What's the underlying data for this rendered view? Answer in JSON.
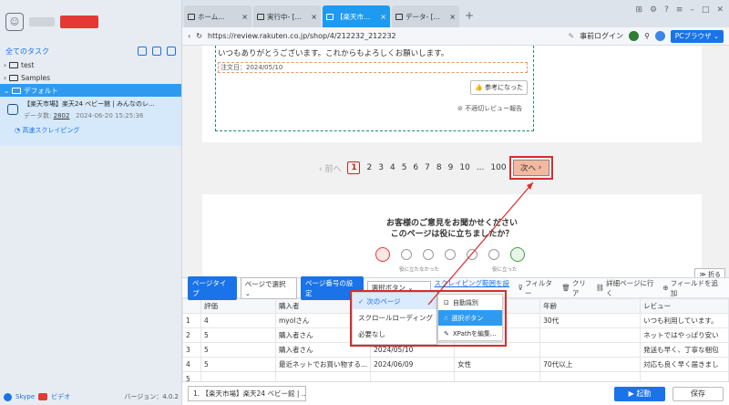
{
  "sidebar": {
    "all_tasks": "全てのタスク",
    "tree": [
      {
        "label": "test"
      },
      {
        "label": "Samples"
      },
      {
        "label": "デフォルト"
      }
    ],
    "task": {
      "title": "【楽天市場】楽天24 ベビー館 | みんなのレ...",
      "count_label": "データ数:",
      "count": "2802",
      "date": "2024-06-20 15:25:36",
      "mode": "高速スクレイピング"
    },
    "footer": {
      "skype": "Skype",
      "video": "ビデオ",
      "version": "バージョン：4.0.2"
    }
  },
  "tabs": [
    {
      "label": "ホーム..."
    },
    {
      "label": "実行中- [..."
    },
    {
      "label": "【楽天市..."
    },
    {
      "label": "データ- [..."
    }
  ],
  "urlbar": {
    "url": "https://review.rakuten.co.jp/shop/4/212232_212232",
    "login": "事前ログイン",
    "browser": "PCブラウザ"
  },
  "page": {
    "thanks": "いつもありがとうございます。これからもよろしくお願いします。",
    "order_date": "注文日：2024/05/10",
    "helpful": "参考になった",
    "report": "不適切レビュー報告",
    "pager": {
      "prev": "前へ",
      "pages": [
        "1",
        "2",
        "3",
        "4",
        "5",
        "6",
        "7",
        "8",
        "9",
        "10"
      ],
      "ellipsis": "...",
      "last": "100",
      "next": "次へ"
    },
    "survey_q1": "お客様のご意見をお聞かせください",
    "survey_q2": "このページは役に立ちましたか？",
    "survey_low": "役に立たなかった",
    "survey_high": "役に立った",
    "fold": "折る"
  },
  "panel": {
    "page_type_label": "ページタイプ",
    "page_type_value": "ページで選択",
    "page_num_label": "ページ番号の設定",
    "select_value": "選択ボタン",
    "scrape_range": "スクレイピング範囲を設定",
    "filter": "フィルター",
    "clear": "クリア",
    "detail": "詳細ページに行く",
    "add_field": "フィールドを追加",
    "columns": [
      "",
      "評価",
      "購入者",
      "",
      "",
      "年齢",
      "レビュー"
    ],
    "rows": [
      [
        "1",
        "4",
        "myolさん",
        "",
        "",
        "30代",
        "いつも利用しています。"
      ],
      [
        "2",
        "5",
        "購入者さん",
        "",
        "",
        "",
        "ネットではやっぱり安い"
      ],
      [
        "3",
        "5",
        "購入者さん",
        "2024/05/10",
        "",
        "",
        "発送も早く、丁寧な梱包"
      ],
      [
        "4",
        "5",
        "最近ネットでお買い物する...",
        "2024/06/09",
        "女性",
        "70代以上",
        "対応も良く早く届きまし"
      ],
      [
        "5",
        "",
        "",
        "",
        "",
        "",
        ""
      ]
    ]
  },
  "dropdown": {
    "items": [
      "次のページ",
      "スクロールローディング",
      "必要なし"
    ],
    "sub": [
      "自動識別",
      "選択ボタン",
      "XPathを編集..."
    ]
  },
  "bottom": {
    "tab": "1. 【楽天市場】楽天24 ベビー館 | ...",
    "start": "起動",
    "save": "保存"
  }
}
